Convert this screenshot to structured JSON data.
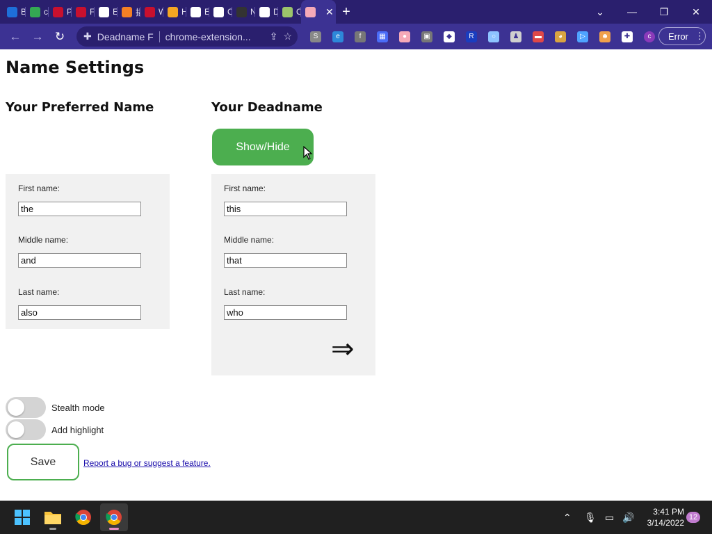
{
  "browser": {
    "tabs": [
      {
        "title": "Bir",
        "icon": "bing-icon",
        "color": "#1e6fd9"
      },
      {
        "title": "chi",
        "icon": "chrome-icon",
        "color": "#34a853"
      },
      {
        "title": "Po",
        "icon": "extension-store-icon",
        "color": "#c8102e"
      },
      {
        "title": "Fo",
        "icon": "extension-store-icon",
        "color": "#c8102e"
      },
      {
        "title": "Ext",
        "icon": "puzzle-icon",
        "color": "#ffffff"
      },
      {
        "title": "插",
        "icon": "stackoverflow-icon",
        "color": "#f48024"
      },
      {
        "title": "W",
        "icon": "extension-store-icon",
        "color": "#c8102e"
      },
      {
        "title": "Ho",
        "icon": "home-icon",
        "color": "#f5a623"
      },
      {
        "title": "Ext",
        "icon": "puzzle-icon",
        "color": "#ffffff"
      },
      {
        "title": "Ch",
        "icon": "plus-circle-icon",
        "color": "#ffffff"
      },
      {
        "title": "Ne",
        "icon": "dark-page-icon",
        "color": "#333333"
      },
      {
        "title": "Dc",
        "icon": "docs-icon",
        "color": "#ffffff"
      },
      {
        "title": "Op",
        "icon": "image-icon",
        "color": "#9cc46b"
      },
      {
        "title": "",
        "icon": "trans-flag-icon",
        "color": "#f5a9b8",
        "active": true
      }
    ],
    "new_tab_label": "+",
    "close_tab_label": "✕",
    "tab_search_label": "⌄",
    "minimize_label": "—",
    "restore_label": "❐",
    "close_window_label": "✕",
    "back_label": "←",
    "forward_label": "→",
    "reload_label": "↻",
    "omnibox": {
      "page_title": "Deadname F",
      "url": "chrome-extension..."
    },
    "error_label": "Error",
    "menu_label": "⋮",
    "profile_initial": "c",
    "extension_icons": [
      {
        "name": "s-extension-icon",
        "color": "#888888",
        "glyph": "S"
      },
      {
        "name": "edge-icon",
        "color": "#2d88d9",
        "glyph": "e"
      },
      {
        "name": "framed-extension-icon",
        "color": "#777777",
        "glyph": "f"
      },
      {
        "name": "grid-extension-icon",
        "color": "#4a6cf7",
        "glyph": "▦"
      },
      {
        "name": "trans-flag-extension-icon",
        "color": "#f5a9b8",
        "glyph": "●"
      },
      {
        "name": "picture-extension-icon",
        "color": "#777777",
        "glyph": "▣"
      },
      {
        "name": "tag-extension-icon",
        "color": "#ffffff",
        "glyph": "◆"
      },
      {
        "name": "r-extension-icon",
        "color": "#1a3dbf",
        "glyph": "R"
      },
      {
        "name": "link-extension-icon",
        "color": "#8ec3ff",
        "glyph": "○"
      },
      {
        "name": "stamp-extension-icon",
        "color": "#cfcfcf",
        "glyph": "♟"
      },
      {
        "name": "red-box-extension-icon",
        "color": "#e04848",
        "glyph": "▬"
      },
      {
        "name": "dog-extension-icon",
        "color": "#d9a441",
        "glyph": "◕"
      },
      {
        "name": "play-extension-icon",
        "color": "#4fa3ff",
        "glyph": "▷"
      },
      {
        "name": "face-extension-icon",
        "color": "#f0a04b",
        "glyph": "☻"
      },
      {
        "name": "puzzle-extensions-icon",
        "color": "#ffffff",
        "glyph": "✚"
      },
      {
        "name": "profile-avatar-icon",
        "color": "#8a3ab9",
        "glyph": "c"
      }
    ]
  },
  "page": {
    "heading": "Name Settings",
    "preferred": {
      "heading": "Your Preferred Name",
      "first_label": "First name:",
      "first_value": "the",
      "middle_label": "Middle name:",
      "middle_value": "and",
      "last_label": "Last name:",
      "last_value": "also"
    },
    "deadname": {
      "heading": "Your Deadname",
      "show_hide_label": "Show/Hide",
      "first_label": "First name:",
      "first_value": "this",
      "middle_label": "Middle name:",
      "middle_value": "that",
      "last_label": "Last name:",
      "last_value": "who",
      "arrow": "⇒"
    },
    "stealth_label": "Stealth mode",
    "highlight_label": "Add highlight",
    "save_label": "Save",
    "report_link": "Report a bug or suggest a feature."
  },
  "taskbar": {
    "time": "3:41 PM",
    "date": "3/14/2022",
    "notification_count": "12",
    "apps": [
      "start-icon",
      "file-explorer-icon",
      "chrome-icon",
      "chrome-icon"
    ]
  },
  "colors": {
    "accent_green": "#4cae4f",
    "toolbar_purple": "#3c3293",
    "tabstrip_purple": "#2a1f6e"
  }
}
